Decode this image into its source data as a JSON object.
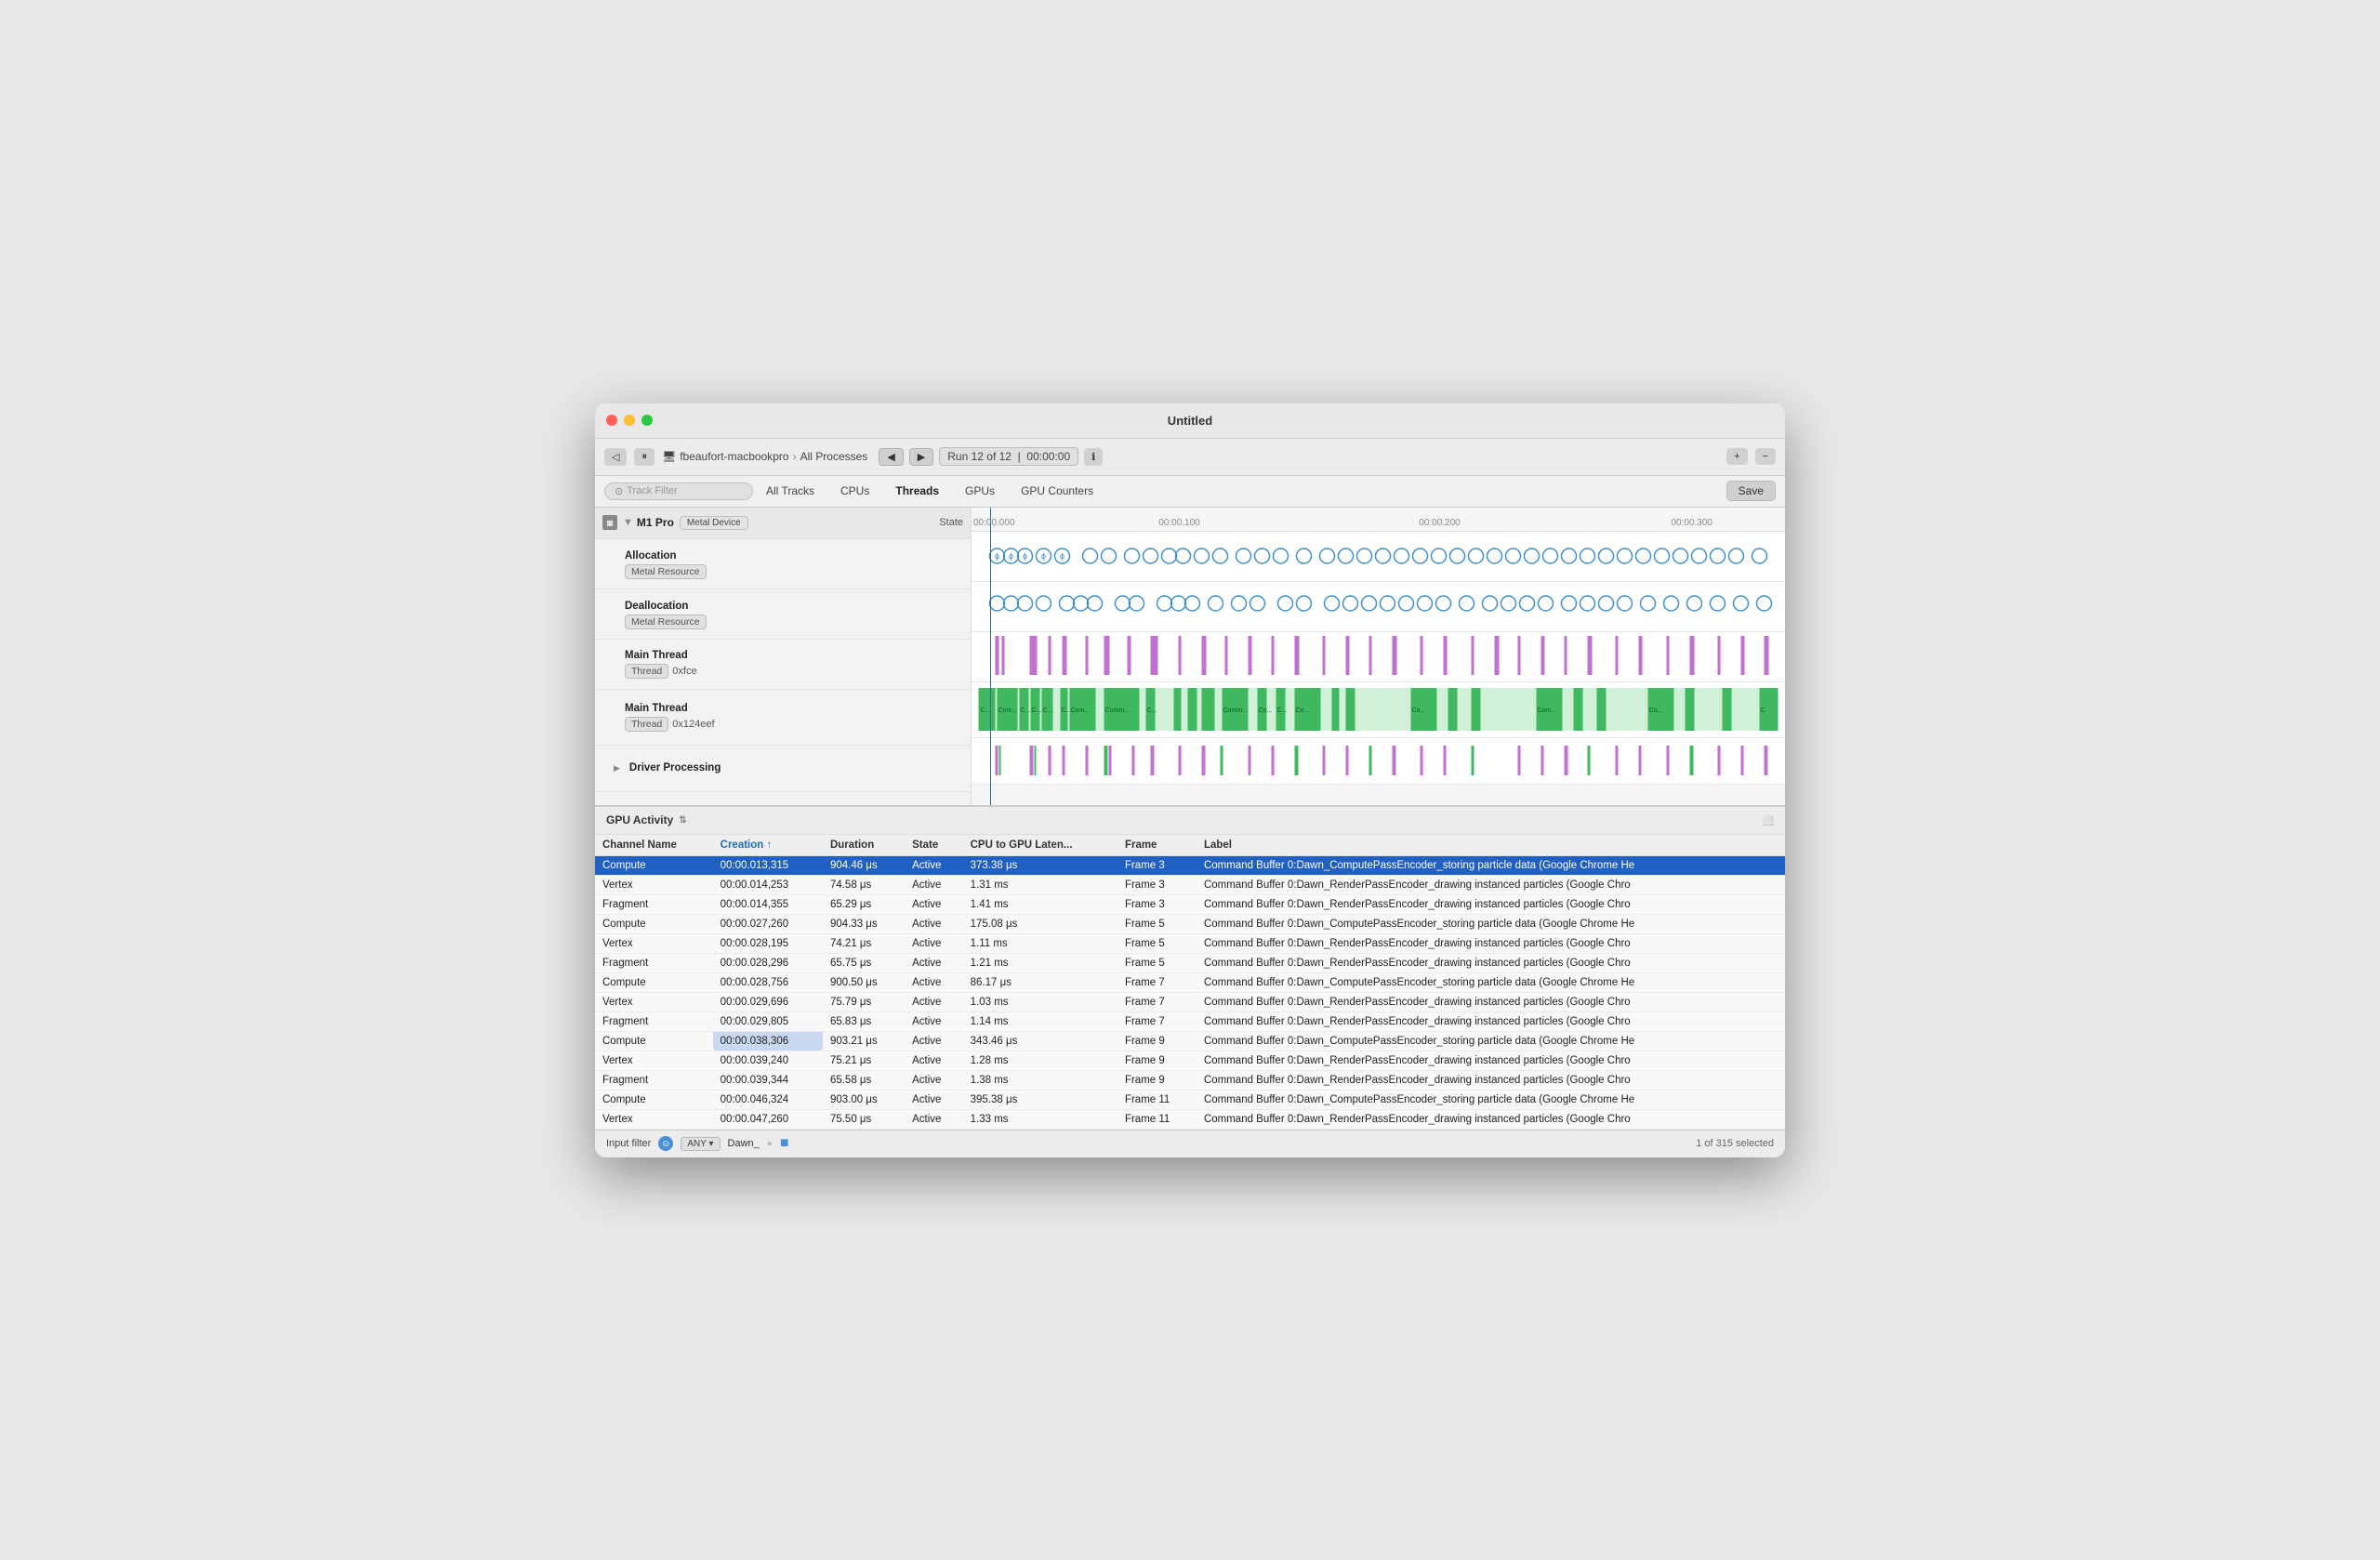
{
  "window": {
    "title": "Untitled"
  },
  "toolbar": {
    "device": "fbeaufort-macbookpro",
    "separator": "›",
    "process": "All Processes",
    "run_label": "Run 12 of 12",
    "run_time": "00:00:00",
    "plus_btn": "+",
    "minus_btn": "−"
  },
  "nav": {
    "search_placeholder": "Track Filter",
    "tabs": [
      "All Tracks",
      "CPUs",
      "Threads",
      "GPUs",
      "GPU Counters"
    ],
    "active_tab": "Threads",
    "save_btn": "Save"
  },
  "timeline": {
    "marks": [
      "00:00.000",
      "00:00.100",
      "00:00.200",
      "00:00.300"
    ]
  },
  "tracks": {
    "device_name": "M1 Pro",
    "device_badge": "Metal Device",
    "state_header": "State",
    "rows": [
      {
        "id": "allocation",
        "label": "Allocation",
        "badge": "Metal Resource",
        "vis_type": "blue_outline"
      },
      {
        "id": "deallocation",
        "label": "Deallocation",
        "badge": "Metal Resource",
        "vis_type": "blue_outline"
      },
      {
        "id": "main_thread_1",
        "label": "Main Thread",
        "badge_label": "Thread",
        "badge_value": "0xfce",
        "vis_type": "purple"
      },
      {
        "id": "main_thread_2",
        "label": "Main Thread",
        "badge_label": "Thread",
        "badge_value": "0x124eef",
        "vis_type": "green_commands"
      },
      {
        "id": "driver_processing",
        "label": "Driver Processing",
        "vis_type": "mixed",
        "expandable": true
      }
    ]
  },
  "gpu_activity": {
    "header": "GPU Activity",
    "columns": [
      "Channel Name",
      "Creation",
      "Duration",
      "State",
      "CPU to GPU Laten...",
      "Frame",
      "Label"
    ],
    "sorted_col": "Creation",
    "rows": [
      {
        "channel": "Compute",
        "creation": "00:00.013,315",
        "duration": "904.46 μs",
        "state": "Active",
        "latency": "373.38 μs",
        "frame": "Frame 3",
        "label": "Command Buffer 0:Dawn_ComputePassEncoder_storing particle data   (Google Chrome He",
        "selected": true
      },
      {
        "channel": "Vertex",
        "creation": "00:00.014,253",
        "duration": "74.58 μs",
        "state": "Active",
        "latency": "1.31 ms",
        "frame": "Frame 3",
        "label": "Command Buffer 0:Dawn_RenderPassEncoder_drawing instanced particles   (Google Chro"
      },
      {
        "channel": "Fragment",
        "creation": "00:00.014,355",
        "duration": "65.29 μs",
        "state": "Active",
        "latency": "1.41 ms",
        "frame": "Frame 3",
        "label": "Command Buffer 0:Dawn_RenderPassEncoder_drawing instanced particles   (Google Chro"
      },
      {
        "channel": "Compute",
        "creation": "00:00.027,260",
        "duration": "904.33 μs",
        "state": "Active",
        "latency": "175.08 μs",
        "frame": "Frame 5",
        "label": "Command Buffer 0:Dawn_ComputePassEncoder_storing particle data   (Google Chrome He"
      },
      {
        "channel": "Vertex",
        "creation": "00:00.028,195",
        "duration": "74.21 μs",
        "state": "Active",
        "latency": "1.11 ms",
        "frame": "Frame 5",
        "label": "Command Buffer 0:Dawn_RenderPassEncoder_drawing instanced particles   (Google Chro"
      },
      {
        "channel": "Fragment",
        "creation": "00:00.028,296",
        "duration": "65.75 μs",
        "state": "Active",
        "latency": "1.21 ms",
        "frame": "Frame 5",
        "label": "Command Buffer 0:Dawn_RenderPassEncoder_drawing instanced particles   (Google Chro"
      },
      {
        "channel": "Compute",
        "creation": "00:00.028,756",
        "duration": "900.50 μs",
        "state": "Active",
        "latency": "86.17 μs",
        "frame": "Frame 7",
        "label": "Command Buffer 0:Dawn_ComputePassEncoder_storing particle data   (Google Chrome He"
      },
      {
        "channel": "Vertex",
        "creation": "00:00.029,696",
        "duration": "75.79 μs",
        "state": "Active",
        "latency": "1.03 ms",
        "frame": "Frame 7",
        "label": "Command Buffer 0:Dawn_RenderPassEncoder_drawing instanced particles   (Google Chro"
      },
      {
        "channel": "Fragment",
        "creation": "00:00.029,805",
        "duration": "65.83 μs",
        "state": "Active",
        "latency": "1.14 ms",
        "frame": "Frame 7",
        "label": "Command Buffer 0:Dawn_RenderPassEncoder_drawing instanced particles   (Google Chro"
      },
      {
        "channel": "Compute",
        "creation": "00:00.038,306",
        "duration": "903.21 μs",
        "state": "Active",
        "latency": "343.46 μs",
        "frame": "Frame 9",
        "label": "Command Buffer 0:Dawn_ComputePassEncoder_storing particle data   (Google Chrome He",
        "highlighted_creation": true
      },
      {
        "channel": "Vertex",
        "creation": "00:00.039,240",
        "duration": "75.21 μs",
        "state": "Active",
        "latency": "1.28 ms",
        "frame": "Frame 9",
        "label": "Command Buffer 0:Dawn_RenderPassEncoder_drawing instanced particles   (Google Chro"
      },
      {
        "channel": "Fragment",
        "creation": "00:00.039,344",
        "duration": "65.58 μs",
        "state": "Active",
        "latency": "1.38 ms",
        "frame": "Frame 9",
        "label": "Command Buffer 0:Dawn_RenderPassEncoder_drawing instanced particles   (Google Chro"
      },
      {
        "channel": "Compute",
        "creation": "00:00.046,324",
        "duration": "903.00 μs",
        "state": "Active",
        "latency": "395.38 μs",
        "frame": "Frame 11",
        "label": "Command Buffer 0:Dawn_ComputePassEncoder_storing particle data   (Google Chrome He"
      },
      {
        "channel": "Vertex",
        "creation": "00:00.047,260",
        "duration": "75.50 μs",
        "state": "Active",
        "latency": "1.33 ms",
        "frame": "Frame 11",
        "label": "Command Buffer 0:Dawn_RenderPassEncoder_drawing instanced particles   (Google Chro"
      }
    ]
  },
  "bottom_bar": {
    "input_filter_label": "Input filter",
    "filter_type": "ANY",
    "filter_value": "Dawn_",
    "result_count": "1 of 315 selected"
  }
}
